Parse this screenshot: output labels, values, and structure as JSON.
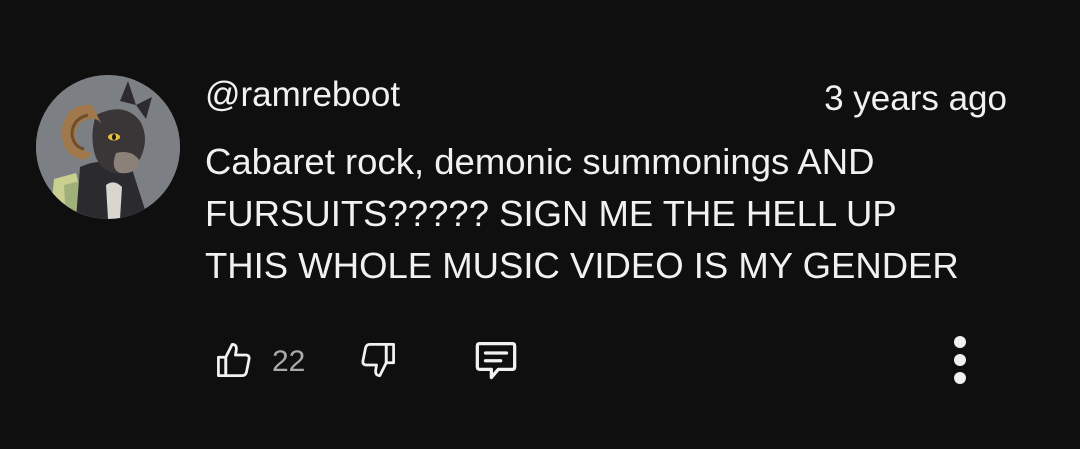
{
  "comment": {
    "author": "@ramreboot",
    "timestamp": "3 years ago",
    "text_lines": [
      "Cabaret rock, demonic summonings AND",
      "FURSUITS????? SIGN ME THE HELL UP",
      "THIS WHOLE MUSIC VIDEO IS MY GENDER"
    ],
    "like_count": "22"
  },
  "icons": {
    "avatar": "avatar-ram-fursuit",
    "like": "thumbs-up-icon",
    "dislike": "thumbs-down-icon",
    "reply": "reply-comment-icon",
    "more": "more-vertical-icon"
  },
  "colors": {
    "background": "#0f0f0f",
    "text": "#f1f1f1",
    "secondary_text": "#aaaaaa",
    "icon": "#f1f1f1"
  }
}
